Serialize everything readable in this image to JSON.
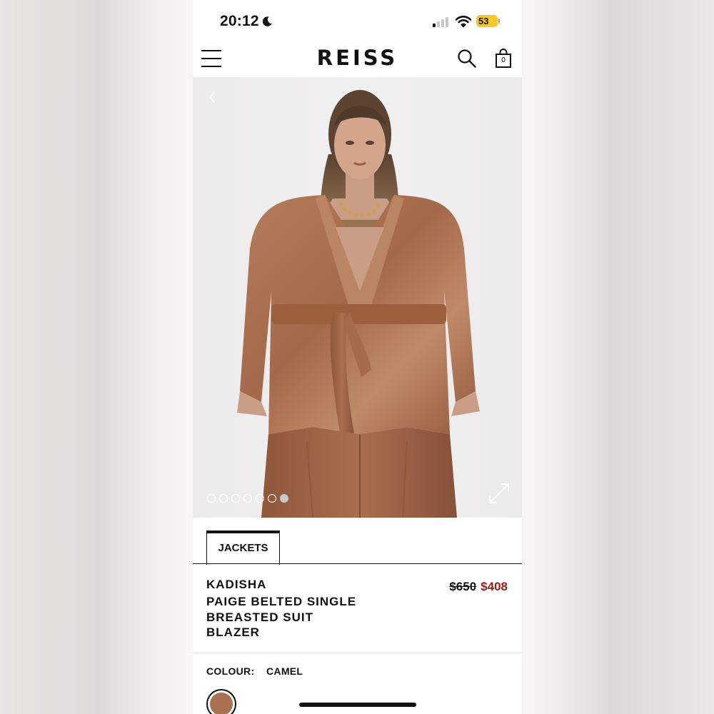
{
  "status_bar": {
    "time": "20:12",
    "battery": "53"
  },
  "header": {
    "logo": "REISS",
    "bag_count": "0"
  },
  "gallery": {
    "image_count": 7,
    "active_index": 6
  },
  "category_tab": {
    "label": "JACKETS"
  },
  "product": {
    "brand": "KADISHA",
    "name": "PAIGE BELTED SINGLE BREASTED SUIT BLAZER",
    "original_price": "$650",
    "sale_price": "$408"
  },
  "colour": {
    "label": "COLOUR:",
    "value": "CAMEL",
    "swatch_color": "#a9714f"
  },
  "colors": {
    "sale_red": "#9b1b1b",
    "battery_yellow": "#f4c92b"
  }
}
